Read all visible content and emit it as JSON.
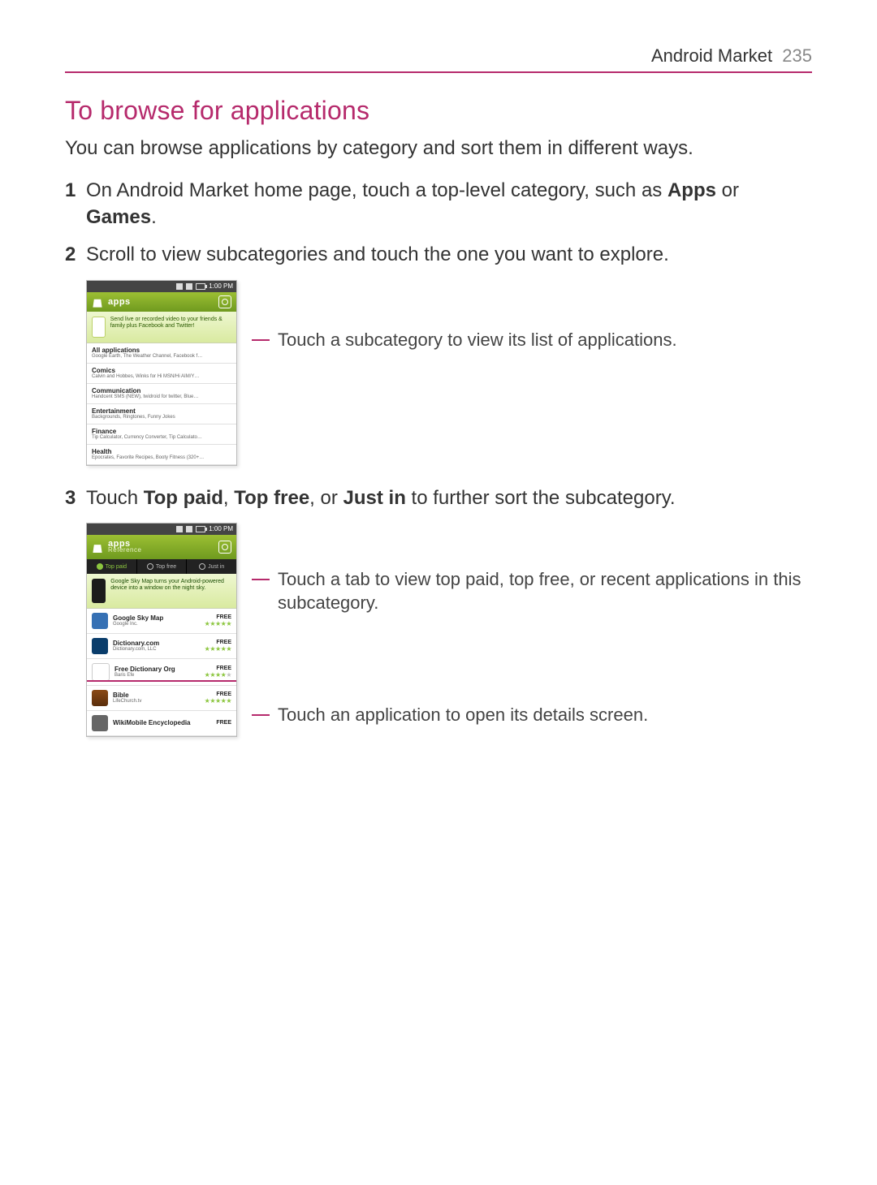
{
  "header": {
    "title": "Android Market",
    "page_number": 235
  },
  "section_title": "To browse for applications",
  "intro": "You can browse applications by category and sort them in different ways.",
  "steps": {
    "1": {
      "pre": "On Android Market home page, touch a top-level category, such as ",
      "bold1": "Apps",
      "mid": " or ",
      "bold2": "Games",
      "post": "."
    },
    "2": {
      "text": "Scroll to view subcategories and touch the one you want to explore."
    },
    "3": {
      "pre": "Touch ",
      "b1": "Top paid",
      "s1": ", ",
      "b2": "Top free",
      "s2": ", or ",
      "b3": "Just in",
      "post": " to further sort the subcategory."
    }
  },
  "callouts": {
    "cat": "Touch a subcategory to view its list of applications.",
    "tabs": "Touch a tab to view top paid, top free, or recent applications in this subcategory.",
    "app": "Touch an application to open its details screen."
  },
  "phone1": {
    "clock": "1:00 PM",
    "apps_label": "apps",
    "banner": "Send live or recorded video to your friends & family plus Facebook and Twitter!",
    "categories": [
      {
        "name": "All applications",
        "sub": "Google Earth, The Weather Channel, Facebook f…"
      },
      {
        "name": "Comics",
        "sub": "Calvin and Hobbes, Winks for Hi MSN/Hi AIM/Y…"
      },
      {
        "name": "Communication",
        "sub": "Handcent SMS (NEW), twidroid for twitter, Blue…"
      },
      {
        "name": "Entertainment",
        "sub": "Backgrounds, Ringtones, Funny Jokes"
      },
      {
        "name": "Finance",
        "sub": "Tip Calculator, Currency Converter, Tip Calculato…"
      },
      {
        "name": "Health",
        "sub": "Epocrates, Favorite Recipes, Booty Fitness (320+…"
      }
    ]
  },
  "phone2": {
    "clock": "1:00 PM",
    "apps_label": "apps",
    "subtitle": "Reference",
    "tabs": [
      "Top paid",
      "Top free",
      "Just in"
    ],
    "feature": "Google Sky Map turns your Android-powered device into a window on the night sky.",
    "apps": [
      {
        "title": "Google Sky Map",
        "publisher": "Google Inc.",
        "price": "FREE",
        "rating": 5
      },
      {
        "title": "Dictionary.com",
        "publisher": "Dictionary.com, LLC",
        "price": "FREE",
        "rating": 5
      },
      {
        "title": "Free Dictionary Org",
        "publisher": "Baris Efe",
        "price": "FREE",
        "rating": 4
      },
      {
        "title": "Bible",
        "publisher": "LifeChurch.tv",
        "price": "FREE",
        "rating": 5
      },
      {
        "title": "WikiMobile Encyclopedia",
        "publisher": "",
        "price": "FREE",
        "rating": 0
      }
    ]
  }
}
